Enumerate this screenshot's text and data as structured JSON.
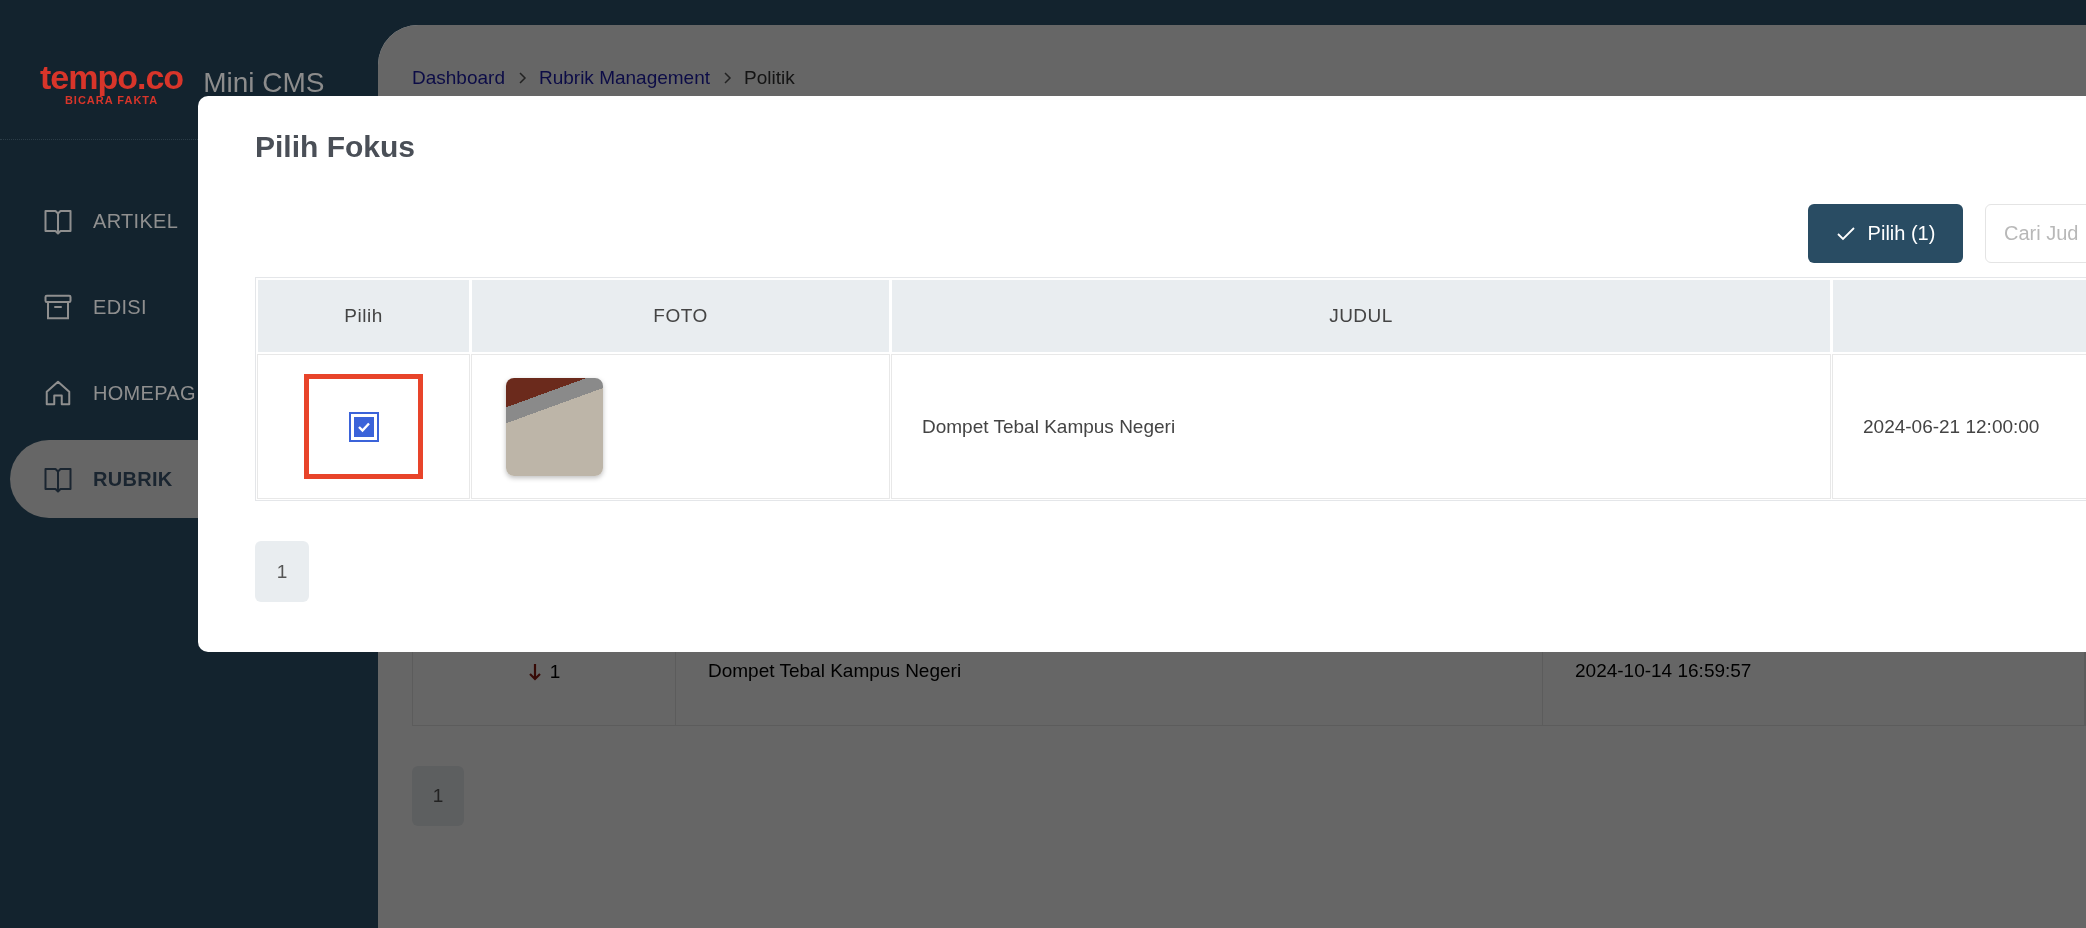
{
  "sidebar": {
    "logo": {
      "wordmark": "tempo.co",
      "tagline": "BICARA FAKTA"
    },
    "app_name": "Mini CMS",
    "items": [
      {
        "label": "ARTIKEL",
        "selected": false
      },
      {
        "label": "EDISI",
        "selected": false
      },
      {
        "label": "HOMEPAG",
        "selected": false
      },
      {
        "label": "RUBRIK",
        "selected": true
      }
    ]
  },
  "breadcrumb": [
    {
      "label": "Dashboard",
      "current": false
    },
    {
      "label": "Rubrik Management",
      "current": false
    },
    {
      "label": "Politik",
      "current": true
    }
  ],
  "background_table": {
    "rows": [
      {
        "order": "1",
        "title": "Dompet Tebal Kampus Negeri",
        "date": "2024-10-14 16:59:57"
      }
    ]
  },
  "background_pagination": [
    "1"
  ],
  "modal": {
    "title": "Pilih Fokus",
    "select_button": "Pilih (1)",
    "search": {
      "placeholder": "Cari Jud"
    },
    "table": {
      "columns": [
        "Pilih",
        "FOTO",
        "JUDUL"
      ],
      "rows": [
        {
          "selected": true,
          "highlighted": true,
          "title": "Dompet Tebal Kampus Negeri",
          "date": "2024-06-21 12:00:00"
        }
      ]
    },
    "pagination": [
      "1"
    ]
  }
}
